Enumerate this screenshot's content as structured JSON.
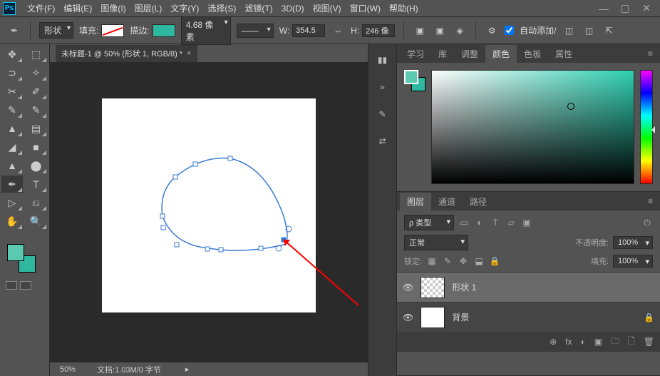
{
  "menu": [
    "文件(F)",
    "编辑(E)",
    "图像(I)",
    "图层(L)",
    "文字(Y)",
    "选择(S)",
    "滤镜(T)",
    "3D(D)",
    "视图(V)",
    "窗口(W)",
    "帮助(H)"
  ],
  "options": {
    "shape_mode": "形状",
    "fill_label": "填充:",
    "stroke_label": "描边:",
    "stroke_width": "4.68 像素",
    "w_label": "W:",
    "w_value": "354.5",
    "h_label": "H:",
    "h_value": "246 像",
    "auto_add": "自动添加/"
  },
  "doc_tab": {
    "title": "未标题-1 @ 50% (形状 1, RGB/8) *"
  },
  "status": {
    "zoom": "50%",
    "doc_info": "文档:1.03M/0 字节"
  },
  "color_panel": {
    "tabs": [
      "学习",
      "库",
      "调整",
      "颜色",
      "色板",
      "属性"
    ],
    "active": 3
  },
  "layers_panel": {
    "tabs": [
      "图层",
      "通道",
      "路径"
    ],
    "active": 0,
    "filter": "ρ 类型",
    "blend": "正常",
    "opacity_label": "不透明度:",
    "opacity": "100%",
    "lock_label": "锁定:",
    "fill_label": "填充:",
    "fill": "100%",
    "layers": [
      {
        "name": "形状 1",
        "selected": true,
        "checker": true
      },
      {
        "name": "背景",
        "locked": true
      }
    ],
    "footer_icons": [
      "⊕",
      "fx",
      "◐",
      "▣",
      "🗀",
      "🗋",
      "🗑"
    ]
  },
  "tools_left": [
    "↔",
    "▭",
    "✥",
    "✄",
    "✎",
    "✎",
    "▤",
    "■",
    "✐",
    "▲",
    "Ø",
    "T",
    "▷",
    "⎌",
    "✋",
    "🔍"
  ]
}
